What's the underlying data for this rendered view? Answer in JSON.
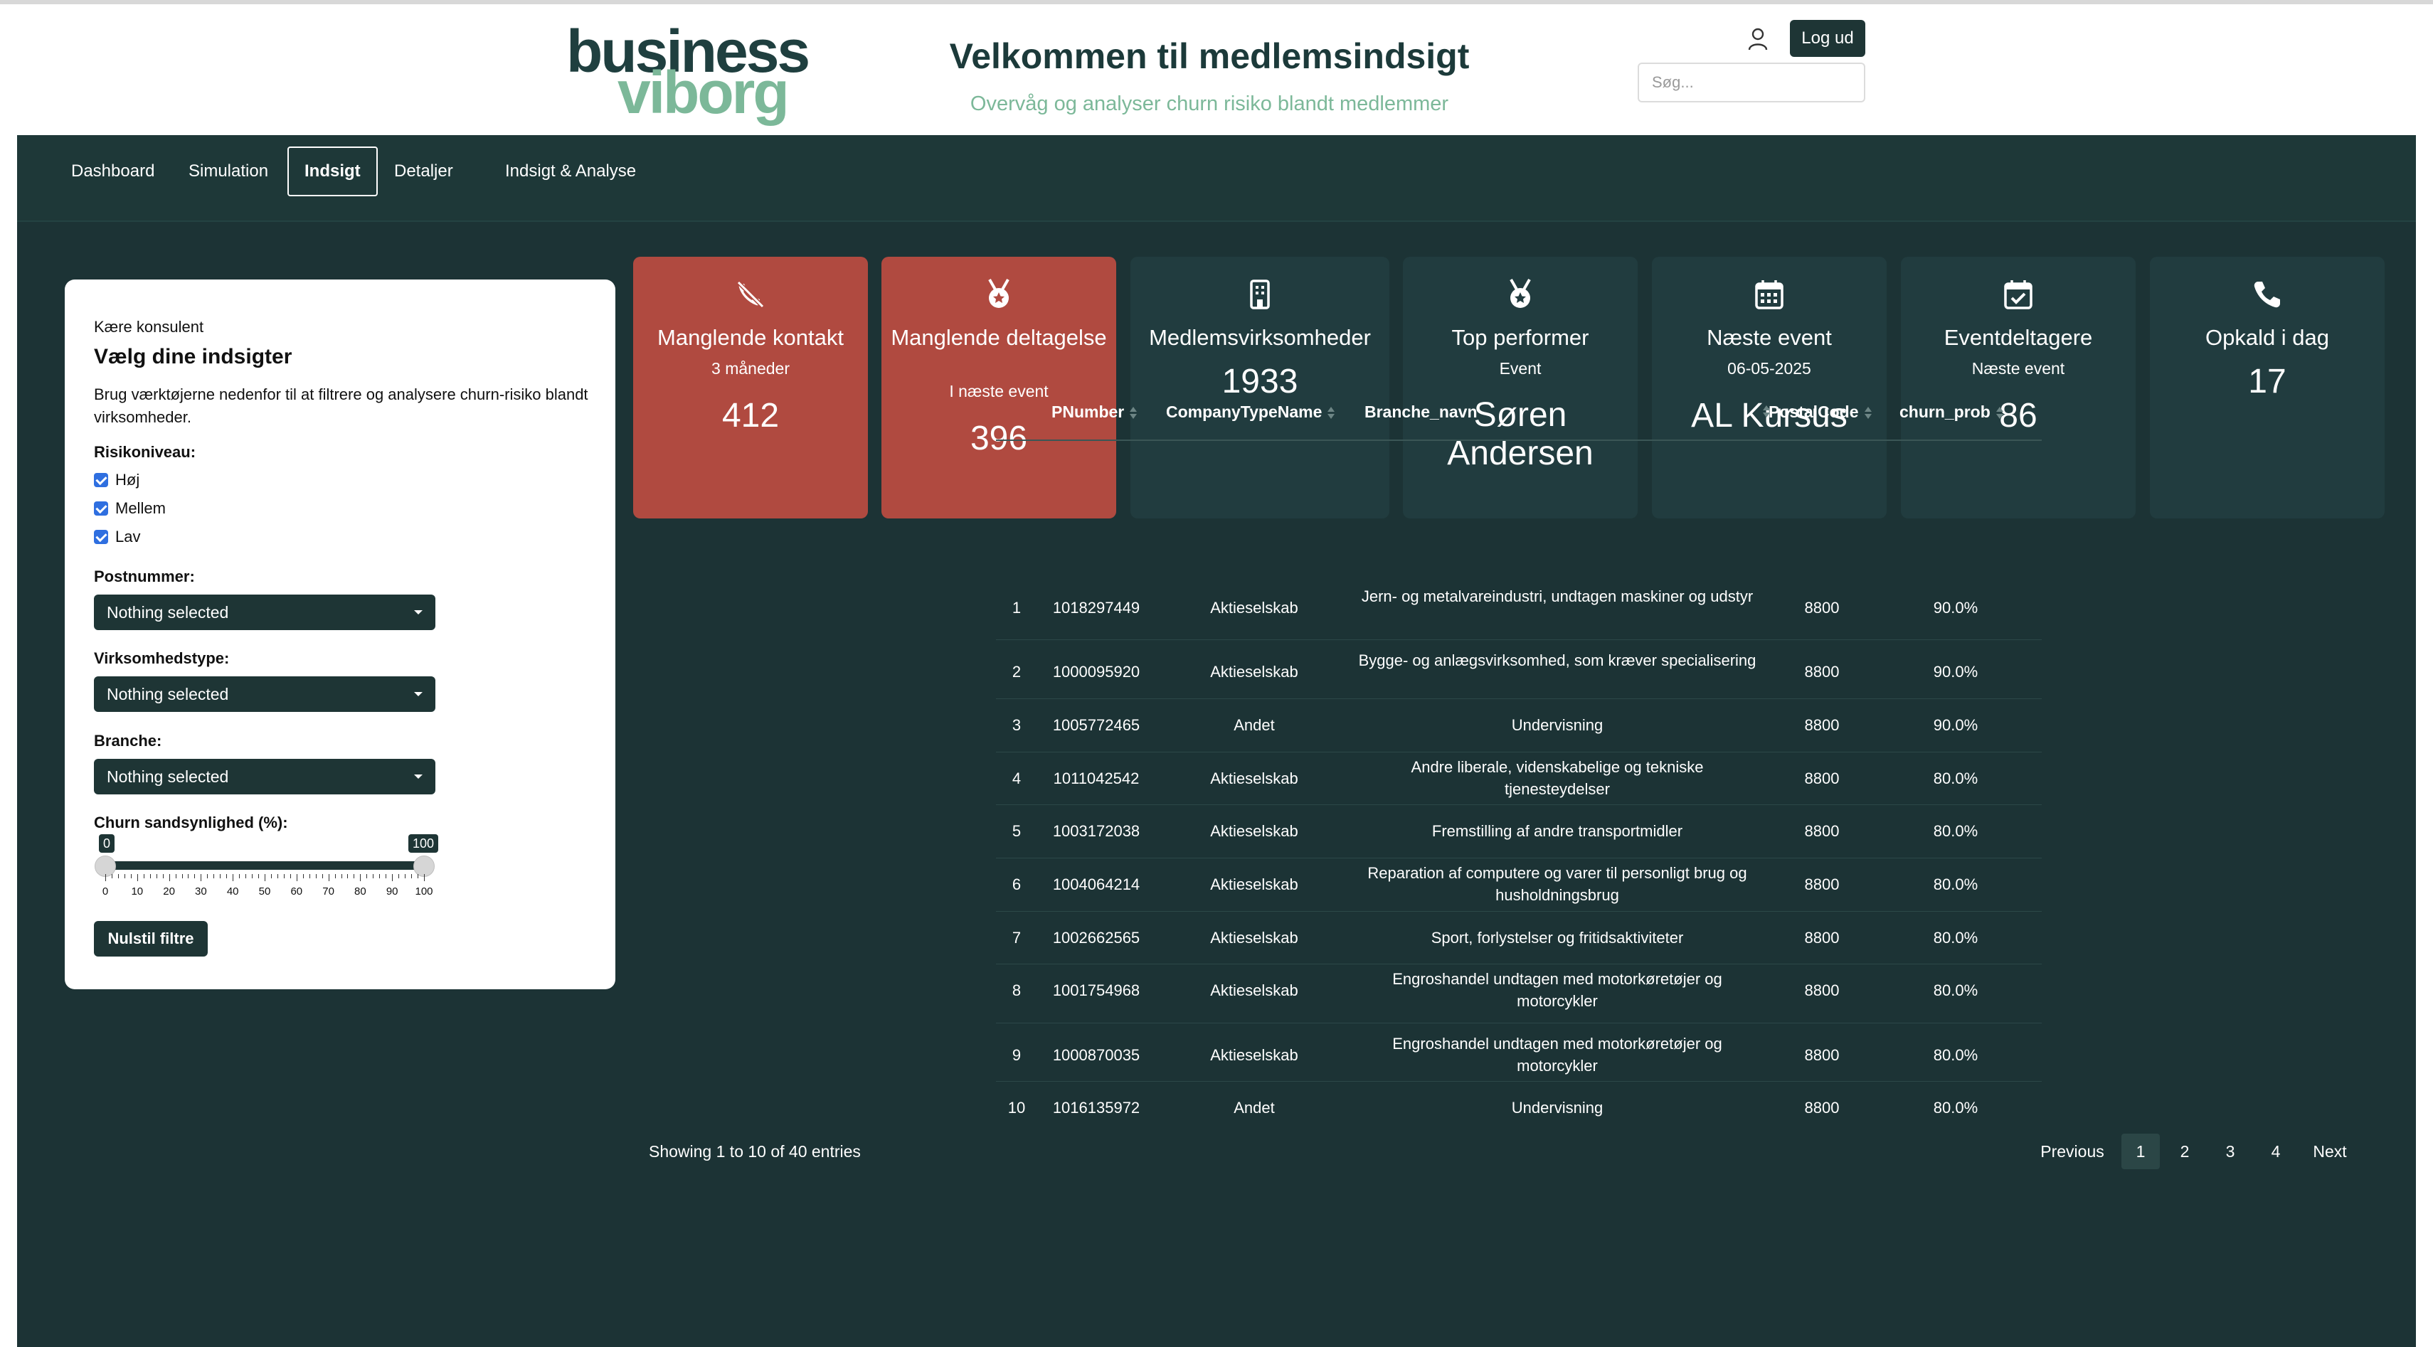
{
  "header": {
    "logo_line1": "business",
    "logo_line2": "viborg",
    "title": "Velkommen til medlemsindsigt",
    "subtitle": "Overvåg og analyser churn risiko blandt medlemmer",
    "logout_label": "Log ud",
    "search_placeholder": "Søg..."
  },
  "nav": {
    "items": [
      {
        "label": "Dashboard"
      },
      {
        "label": "Simulation"
      },
      {
        "label": "Indsigt",
        "active": true
      },
      {
        "label": "Detaljer"
      },
      {
        "label": "Indsigt & Analyse"
      }
    ]
  },
  "filters": {
    "greeting": "Kære konsulent",
    "title": "Vælg dine indsigter",
    "description": "Brug værktøjerne nedenfor til at filtrere og analysere churn-risiko blandt virksomheder.",
    "risk_label": "Risikoniveau:",
    "risk_options": [
      {
        "label": "Høj",
        "checked": true
      },
      {
        "label": "Mellem",
        "checked": true
      },
      {
        "label": "Lav",
        "checked": true
      }
    ],
    "postal_label": "Postnummer:",
    "postal_value": "Nothing selected",
    "company_type_label": "Virksomhedstype:",
    "company_type_value": "Nothing selected",
    "branche_label": "Branche:",
    "branche_value": "Nothing selected",
    "churn_label": "Churn sandsynlighed (%):",
    "churn_min": "0",
    "churn_max": "100",
    "tick_labels": [
      "0",
      "10",
      "20",
      "30",
      "40",
      "50",
      "60",
      "70",
      "80",
      "90",
      "100"
    ],
    "reset_label": "Nulstil filtre"
  },
  "kpis": [
    {
      "title": "Manglende kontakt",
      "sub": "3 måneder",
      "value": "412",
      "icon": "phone-slash-icon",
      "color": "#b04a40"
    },
    {
      "title": "Manglende deltagelse",
      "sub": "I næste event",
      "value": "396",
      "icon": "medal-icon",
      "color": "#b04a40"
    },
    {
      "title": "Medlemsvirksomheder",
      "sub": "",
      "value": "1933",
      "icon": "building-icon",
      "color": "#213c3f"
    },
    {
      "title": "Top performer",
      "sub": "Event",
      "value": "Søren Andersen",
      "icon": "medal-icon",
      "color": "#213c3f"
    },
    {
      "title": "Næste event",
      "sub": "06-05-2025",
      "value": "AL Kursus",
      "icon": "calendar-icon",
      "color": "#213c3f"
    },
    {
      "title": "Eventdeltagere",
      "sub": "Næste event",
      "value": "86",
      "icon": "calendar-check-icon",
      "color": "#213c3f"
    },
    {
      "title": "Opkald i dag",
      "sub": "",
      "value": "17",
      "icon": "phone-icon",
      "color": "#213c3f"
    }
  ],
  "table": {
    "columns": [
      "PNumber",
      "CompanyTypeName",
      "Branche_navn",
      "PostalCode",
      "churn_prob"
    ],
    "rows": [
      {
        "idx": "1",
        "pnumber": "1018297449",
        "type": "Aktieselskab",
        "branche": "Jern- og metalvareindustri, undtagen maskiner og udstyr",
        "postal": "8800",
        "churn": "90.0%"
      },
      {
        "idx": "2",
        "pnumber": "1000095920",
        "type": "Aktieselskab",
        "branche": "Bygge- og anlægsvirksomhed, som kræver specialisering",
        "postal": "8800",
        "churn": "90.0%"
      },
      {
        "idx": "3",
        "pnumber": "1005772465",
        "type": "Andet",
        "branche": "Undervisning",
        "postal": "8800",
        "churn": "90.0%"
      },
      {
        "idx": "4",
        "pnumber": "1011042542",
        "type": "Aktieselskab",
        "branche": "Andre liberale, videnskabelige og tekniske tjenesteydelser",
        "postal": "8800",
        "churn": "80.0%"
      },
      {
        "idx": "5",
        "pnumber": "1003172038",
        "type": "Aktieselskab",
        "branche": "Fremstilling af andre transportmidler",
        "postal": "8800",
        "churn": "80.0%"
      },
      {
        "idx": "6",
        "pnumber": "1004064214",
        "type": "Aktieselskab",
        "branche": "Reparation af computere og varer til personligt brug og husholdningsbrug",
        "postal": "8800",
        "churn": "80.0%"
      },
      {
        "idx": "7",
        "pnumber": "1002662565",
        "type": "Aktieselskab",
        "branche": "Sport, forlystelser og fritidsaktiviteter",
        "postal": "8800",
        "churn": "80.0%"
      },
      {
        "idx": "8",
        "pnumber": "1001754968",
        "type": "Aktieselskab",
        "branche": "Engroshandel undtagen med motorkøretøjer og motorcykler",
        "postal": "8800",
        "churn": "80.0%"
      },
      {
        "idx": "9",
        "pnumber": "1000870035",
        "type": "Aktieselskab",
        "branche": "Engroshandel undtagen med motorkøretøjer og motorcykler",
        "postal": "8800",
        "churn": "80.0%"
      },
      {
        "idx": "10",
        "pnumber": "1016135972",
        "type": "Andet",
        "branche": "Undervisning",
        "postal": "8800",
        "churn": "80.0%"
      }
    ],
    "info": "Showing 1 to 10 of 40 entries",
    "pagination": {
      "previous": "Previous",
      "pages": [
        "1",
        "2",
        "3",
        "4"
      ],
      "current": "1",
      "next": "Next"
    }
  }
}
